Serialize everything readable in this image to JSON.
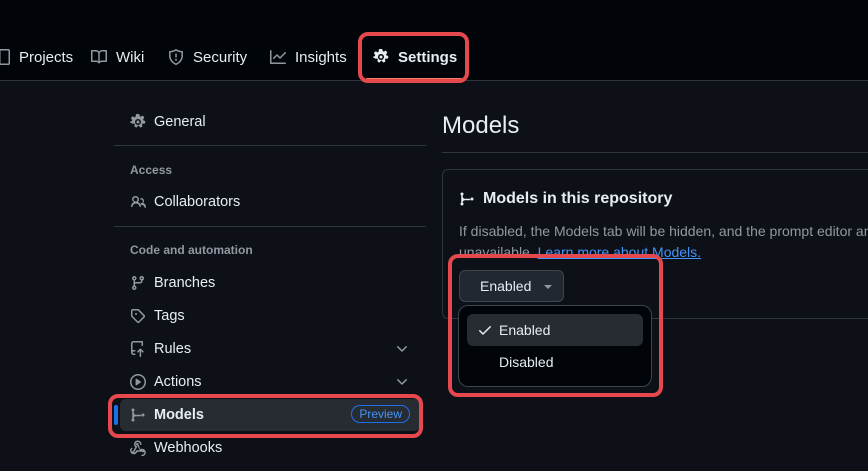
{
  "repo_tabs": [
    {
      "label": "Projects",
      "icon": "table-icon"
    },
    {
      "label": "Wiki",
      "icon": "book-icon"
    },
    {
      "label": "Security",
      "icon": "shield-icon"
    },
    {
      "label": "Insights",
      "icon": "graph-icon"
    },
    {
      "label": "Settings",
      "icon": "gear-icon",
      "active": true
    }
  ],
  "sidebar": {
    "general": "General",
    "access_heading": "Access",
    "collaborators": "Collaborators",
    "code_heading": "Code and automation",
    "branches": "Branches",
    "tags": "Tags",
    "rules": "Rules",
    "actions": "Actions",
    "models": "Models",
    "models_badge": "Preview",
    "webhooks": "Webhooks"
  },
  "main": {
    "title": "Models",
    "card_title": "Models in this repository",
    "desc_line1": "If disabled, the Models tab will be hidden, and the prompt editor and",
    "desc_line2_prefix": "unavailable. ",
    "desc_link": "Learn more about Models.",
    "select_value": "Enabled",
    "menu_options": [
      "Enabled",
      "Disabled"
    ]
  },
  "colors": {
    "highlight": "#e5484d",
    "accent": "#1f6feb",
    "link": "#4493f8",
    "tab_underline": "#f78166"
  }
}
